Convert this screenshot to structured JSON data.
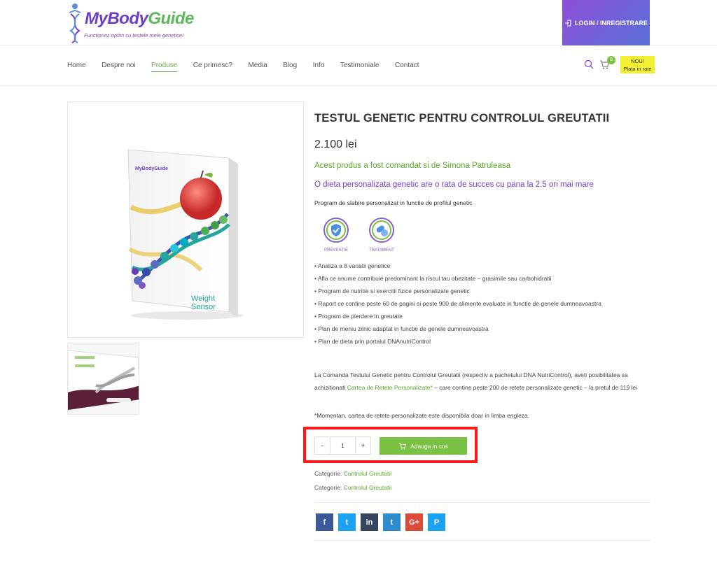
{
  "brand": {
    "name_part1": "My",
    "name_part2": "Body",
    "name_part3": "Guide",
    "tagline": "Functionez optim cu testele mele genetice!"
  },
  "header": {
    "login_label": "LOGIN / INREGISTRARE",
    "cart_count": "0",
    "promo_line1": "NOU!",
    "promo_line2": "Plata in rate"
  },
  "nav": {
    "items": [
      "Home",
      "Despre noi",
      "Produse",
      "Ce primesc?",
      "Media",
      "Blog",
      "Info",
      "Testimoniale",
      "Contact"
    ],
    "active": "Produse"
  },
  "product": {
    "title": "TESTUL GENETIC PENTRU CONTROLUL GREUTATII",
    "price": "2.100 lei",
    "ordered_by": "Acest produs a fost comandat si de Simona Patruleasa",
    "diet_claim": "O dieta personalizata genetic are o rata de succes cu pana la 2.5 ori mai mare",
    "description": "Program de slabire personalizat in functie de profilul genetic",
    "badges": [
      "PREVENTIE",
      "TRATAMENT"
    ],
    "bullets": [
      "• Analiza a 8 variatii genetice",
      "• Afla ce anume contribuie predominant la riscul tau obezitate – grasimile sau carbohidratii",
      "• Program de nutritie si exercitii fizice personalizate genetic",
      "• Raport ce contine peste 60 de pagini si peste 900 de alimente evaluate in functie de genele dumneavoastra",
      "• Program de pierdere in greutate",
      "• Plan de meniu zilnic adaptat in functie de genele dumneavoastra",
      "• Plan de dieta prin portalul DNAnutriControl"
    ],
    "para_before": "La Comanda Testului Genetic pentru Controlul Greutatii (respectiv a pachetului DNA NutriControl), aveti posibilitatea sa achizitionati ",
    "para_link": "Cartea de Retete Personalizate*",
    "para_after": " – care contine peste 200 de retete personalizate genetic – la pretul de 119 lei",
    "note": "*Momentan, cartea de retete personalizate este disponibila doar in limba engleza.",
    "quantity": "1",
    "minus": "-",
    "plus": "+",
    "add_to_cart": "Adauga in cos",
    "category_label": "Categorie:",
    "category": "Controlul Greutatii",
    "image_label_line1": "Weight",
    "image_label_line2": "Sensor",
    "book_brand": "MyBodyGuide"
  },
  "social": [
    {
      "icon": "f",
      "name": "facebook",
      "color": "#3b5998"
    },
    {
      "icon": "t",
      "name": "twitter",
      "color": "#1da1f2"
    },
    {
      "icon": "in",
      "name": "linkedin",
      "color": "#34465d"
    },
    {
      "icon": "t",
      "name": "tumblr",
      "color": "#2e8bcd"
    },
    {
      "icon": "G+",
      "name": "google-plus",
      "color": "#dc4a38"
    },
    {
      "icon": "P",
      "name": "pinterest",
      "color": "#1da1f2"
    }
  ],
  "colors": {
    "accent_green": "#7ac143",
    "accent_purple": "#7a3fc9",
    "highlight": "#ff1a1a"
  }
}
